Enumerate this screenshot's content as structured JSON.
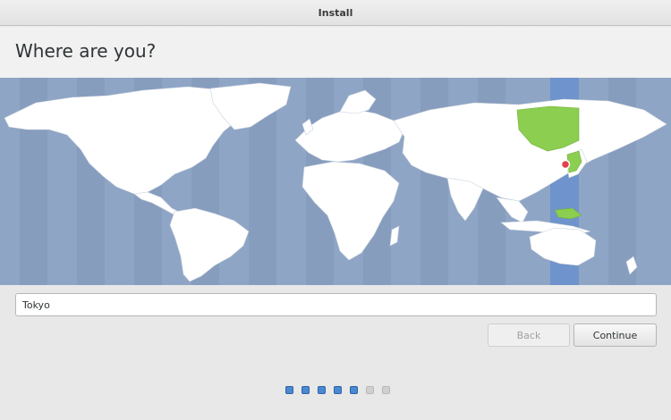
{
  "window": {
    "title": "Install"
  },
  "header": {
    "title": "Where are you?"
  },
  "map": {
    "selected_zone": "Tokyo",
    "colors": {
      "ocean": "#8fa5c5",
      "land": "#ffffff",
      "highlight_band": "#6f93cc",
      "selected_land": "#8bce50",
      "marker": "#e0424b"
    }
  },
  "location": {
    "value": "Tokyo",
    "placeholder": ""
  },
  "buttons": {
    "back": "Back",
    "continue": "Continue"
  },
  "progress": {
    "total_steps": 7,
    "completed_steps": 5,
    "colors": {
      "done": "#4a88d0",
      "todo": "#d0d0d0"
    }
  }
}
